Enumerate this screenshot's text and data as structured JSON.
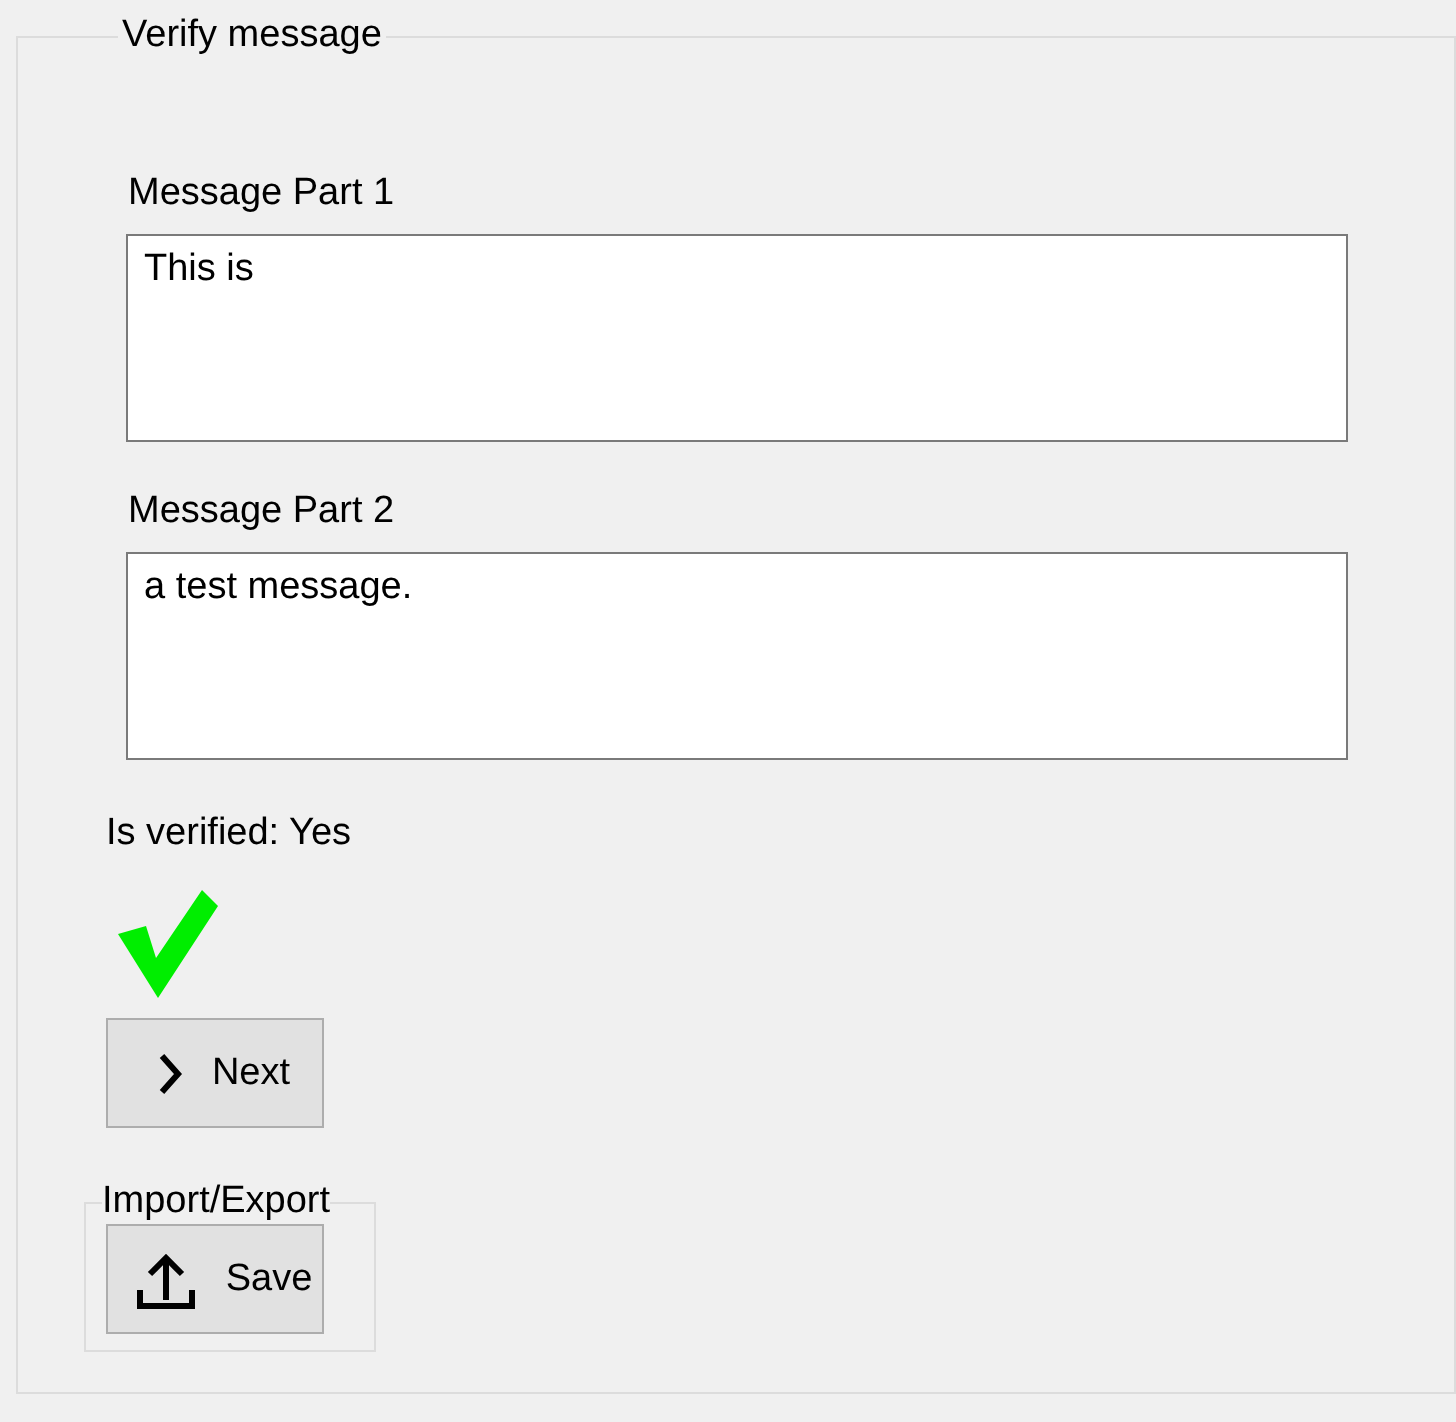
{
  "group": {
    "title": "Verify message"
  },
  "fields": [
    {
      "label": "Message Part 1",
      "value": "This is"
    },
    {
      "label": "Message Part 2",
      "value": "a test message."
    }
  ],
  "status": {
    "text": "Is verified: Yes",
    "verified": true
  },
  "buttons": [
    {
      "kind": "next",
      "label": "Next"
    }
  ],
  "import_export": {
    "title": "Import/Export",
    "buttons": [
      {
        "kind": "save",
        "label": "Save"
      }
    ]
  }
}
